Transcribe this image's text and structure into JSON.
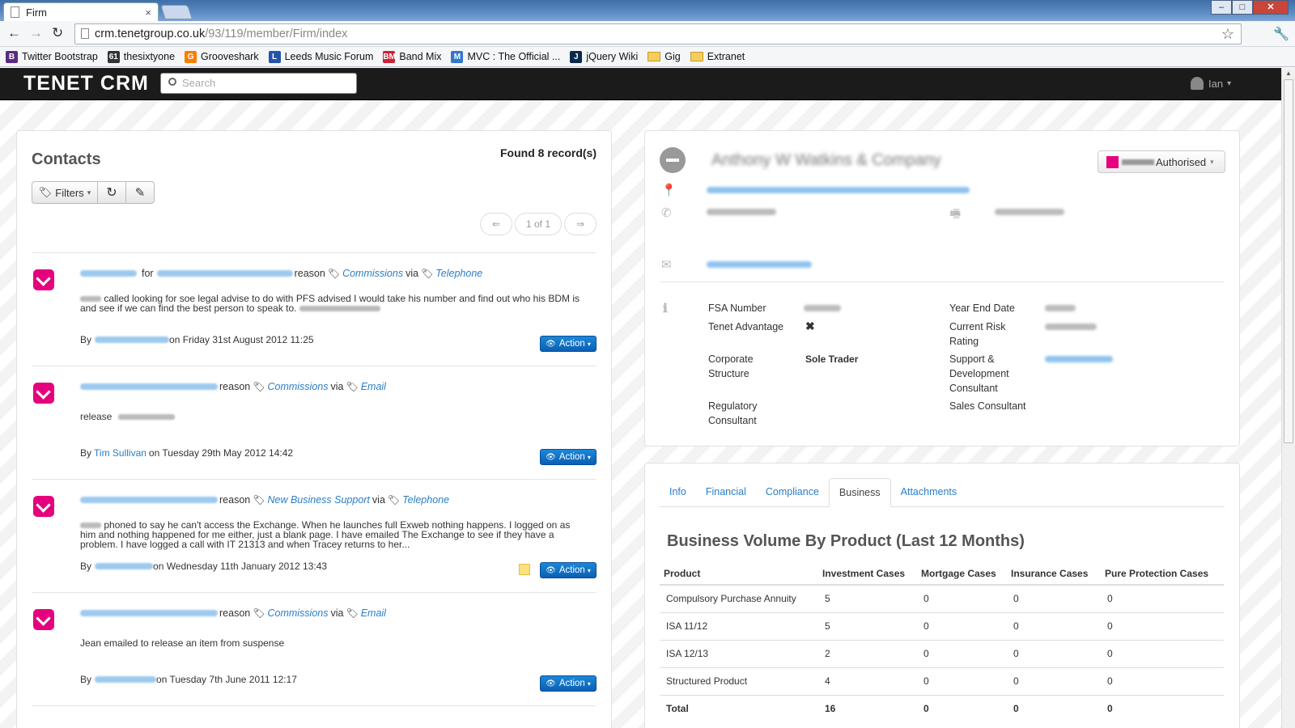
{
  "browser": {
    "tab_title": "Firm",
    "tab_close": "×",
    "win_min": "–",
    "win_max": "□",
    "win_close": "✕",
    "url_host": "crm.tenetgroup.co.uk",
    "url_path": "/93/119/member/Firm/index",
    "back": "←",
    "forward": "→",
    "reload": "↻",
    "star": "☆",
    "wrench": "🔧",
    "bookmarks": [
      {
        "label": "Twitter Bootstrap",
        "icon": "B",
        "color": "#5b2b80"
      },
      {
        "label": "thesixtyone",
        "icon": "61",
        "color": "#333333"
      },
      {
        "label": "Grooveshark",
        "icon": "G",
        "color": "#f77f00"
      },
      {
        "label": "Leeds Music Forum",
        "icon": "L",
        "color": "#2255aa"
      },
      {
        "label": "Band Mix",
        "icon": "BM",
        "color": "#cc2233"
      },
      {
        "label": "MVC : The Official ...",
        "icon": "M",
        "color": "#3377cc"
      },
      {
        "label": "jQuery Wiki",
        "icon": "J",
        "color": "#0b2a4a"
      },
      {
        "label": "Gig",
        "icon": "folder",
        "color": "#f5cd5a"
      },
      {
        "label": "Extranet",
        "icon": "folder",
        "color": "#f5cd5a"
      }
    ]
  },
  "navbar": {
    "brand": "TENET CRM",
    "search_placeholder": "Search",
    "user": "Ian",
    "caret": "▾"
  },
  "contacts": {
    "title": "Contacts",
    "found": "Found 8 record(s)",
    "filters_label": "Filters",
    "refresh_icon": "↻",
    "edit_icon": "✎",
    "pager": {
      "prev": "⇐",
      "info": "1 of 1",
      "next": "⇒"
    },
    "notes": [
      {
        "for_word": "for",
        "reason_word": "reason",
        "reason": "Commissions",
        "via_word": "via",
        "method": "Telephone",
        "body": "called looking for soe legal advise to do with PFS advised I would take his number and find out who his BDM is and see if we can find the best person to speak to.",
        "by_word": "By",
        "date": "on Friday 31st August 2012 11:25",
        "action": "Action"
      },
      {
        "reason_word": "reason",
        "reason": "Commissions",
        "via_word": "via",
        "method": "Email",
        "body": "release",
        "by_word": "By",
        "author": "Tim Sullivan",
        "date": "on Tuesday 29th May 2012 14:42",
        "action": "Action"
      },
      {
        "reason_word": "reason",
        "reason": "New Business Support",
        "via_word": "via",
        "method": "Telephone",
        "body": "phoned to say he can't access the Exchange. When he launches full Exweb nothing happens. I logged on as him and nothing happened for me either, just a blank page. I have emailed The Exchange to see if they have a problem. I have logged a call with IT 21313 and when Tracey returns to her...",
        "by_word": "By",
        "date": "on Wednesday 11th January 2012 13:43",
        "action": "Action"
      },
      {
        "reason_word": "reason",
        "reason": "Commissions",
        "via_word": "via",
        "method": "Email",
        "body": "Jean emailed to release an item from suspense",
        "by_word": "By",
        "date": "on Tuesday 7th June 2011 12:17",
        "action": "Action"
      }
    ]
  },
  "firm": {
    "name": "Anthony W Watkins & Company",
    "status_label": "Authorised",
    "status_color": "#e5007e",
    "fields": {
      "fsa_number_label": "FSA Number",
      "tenet_advantage_label": "Tenet Advantage",
      "tenet_advantage_value": "✖",
      "corporate_structure_label": "Corporate Structure",
      "corporate_structure_value": "Sole Trader",
      "regulatory_consultant_label": "Regulatory Consultant",
      "year_end_date_label": "Year End Date",
      "current_risk_rating_label": "Current Risk Rating",
      "support_dev_consultant_label": "Support & Development Consultant",
      "sales_consultant_label": "Sales Consultant"
    }
  },
  "business": {
    "tabs": [
      "Info",
      "Financial",
      "Compliance",
      "Business",
      "Attachments"
    ],
    "active_tab": "Business",
    "title": "Business Volume By Product (Last 12 Months)",
    "columns": [
      "Product",
      "Investment Cases",
      "Mortgage Cases",
      "Insurance Cases",
      "Pure Protection Cases"
    ],
    "rows": [
      [
        "Compulsory Purchase Annuity",
        "5",
        "0",
        "0",
        "0"
      ],
      [
        "ISA 11/12",
        "5",
        "0",
        "0",
        "0"
      ],
      [
        "ISA 12/13",
        "2",
        "0",
        "0",
        "0"
      ],
      [
        "Structured Product",
        "4",
        "0",
        "0",
        "0"
      ],
      [
        "Total",
        "16",
        "0",
        "0",
        "0"
      ]
    ]
  }
}
